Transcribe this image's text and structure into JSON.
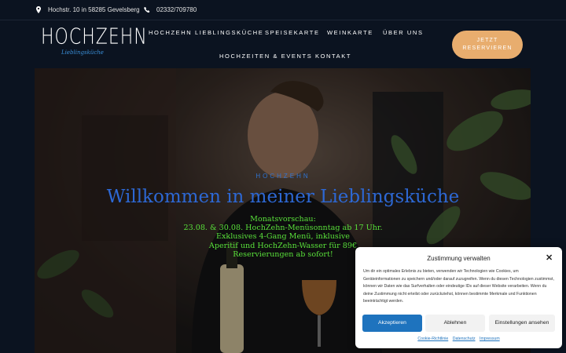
{
  "topbar": {
    "address": "Hochstr. 10 in 58285 Gevelsberg",
    "phone": "02332/709780"
  },
  "logo": {
    "main": "HOCHZEHN",
    "sub": "Lieblingsküche"
  },
  "nav": {
    "items": [
      "HOCHZEHN LIEBLINGSKÜCHE",
      "SPEISEKARTE",
      "WEINKARTE",
      "ÜBER UNS",
      "HOCHZEITEN & EVENTS",
      "KONTAKT"
    ],
    "cta_line1": "JETZT",
    "cta_line2": "RESERVIEREN"
  },
  "hero": {
    "eyebrow": "HOCHZEHN",
    "title": "Willkommen in meiner Lieblingsküche",
    "lines": [
      "Monatsvorschau:",
      "23.08. & 30.08. HochZehn-Menüsonntag ab 17 Uhr.",
      "Exklusives 4-Gang Menü, inklusive",
      "Aperitif und HochZehn-Wasser für 89€",
      "Reservierungen ab sofort!"
    ]
  },
  "consent": {
    "title": "Zustimmung verwalten",
    "body": "Um dir ein optimales Erlebnis zu bieten, verwenden wir Technologien wie Cookies, um Geräteinformationen zu speichern und/oder darauf zuzugreifen. Wenn du diesen Technologien zustimmst, können wir Daten wie das Surfverhalten oder eindeutige IDs auf dieser Website verarbeiten. Wenn du deine Zustimmung nicht erteilst oder zurückziehst, können bestimmte Merkmale und Funktionen beeinträchtigt werden.",
    "accept": "Akzeptieren",
    "deny": "Ablehnen",
    "settings": "Einstellungen ansehen",
    "links": [
      "Cookie-Richtlinie",
      "Datenschutz",
      "Impressum"
    ]
  },
  "colors": {
    "background": "#0b1320",
    "accent_button": "#e8ad6e",
    "hero_title": "#2d68d4",
    "hero_text": "#59e03a",
    "consent_primary": "#1e73be"
  },
  "icons": [
    "map-pin-icon",
    "phone-icon",
    "close-icon"
  ]
}
